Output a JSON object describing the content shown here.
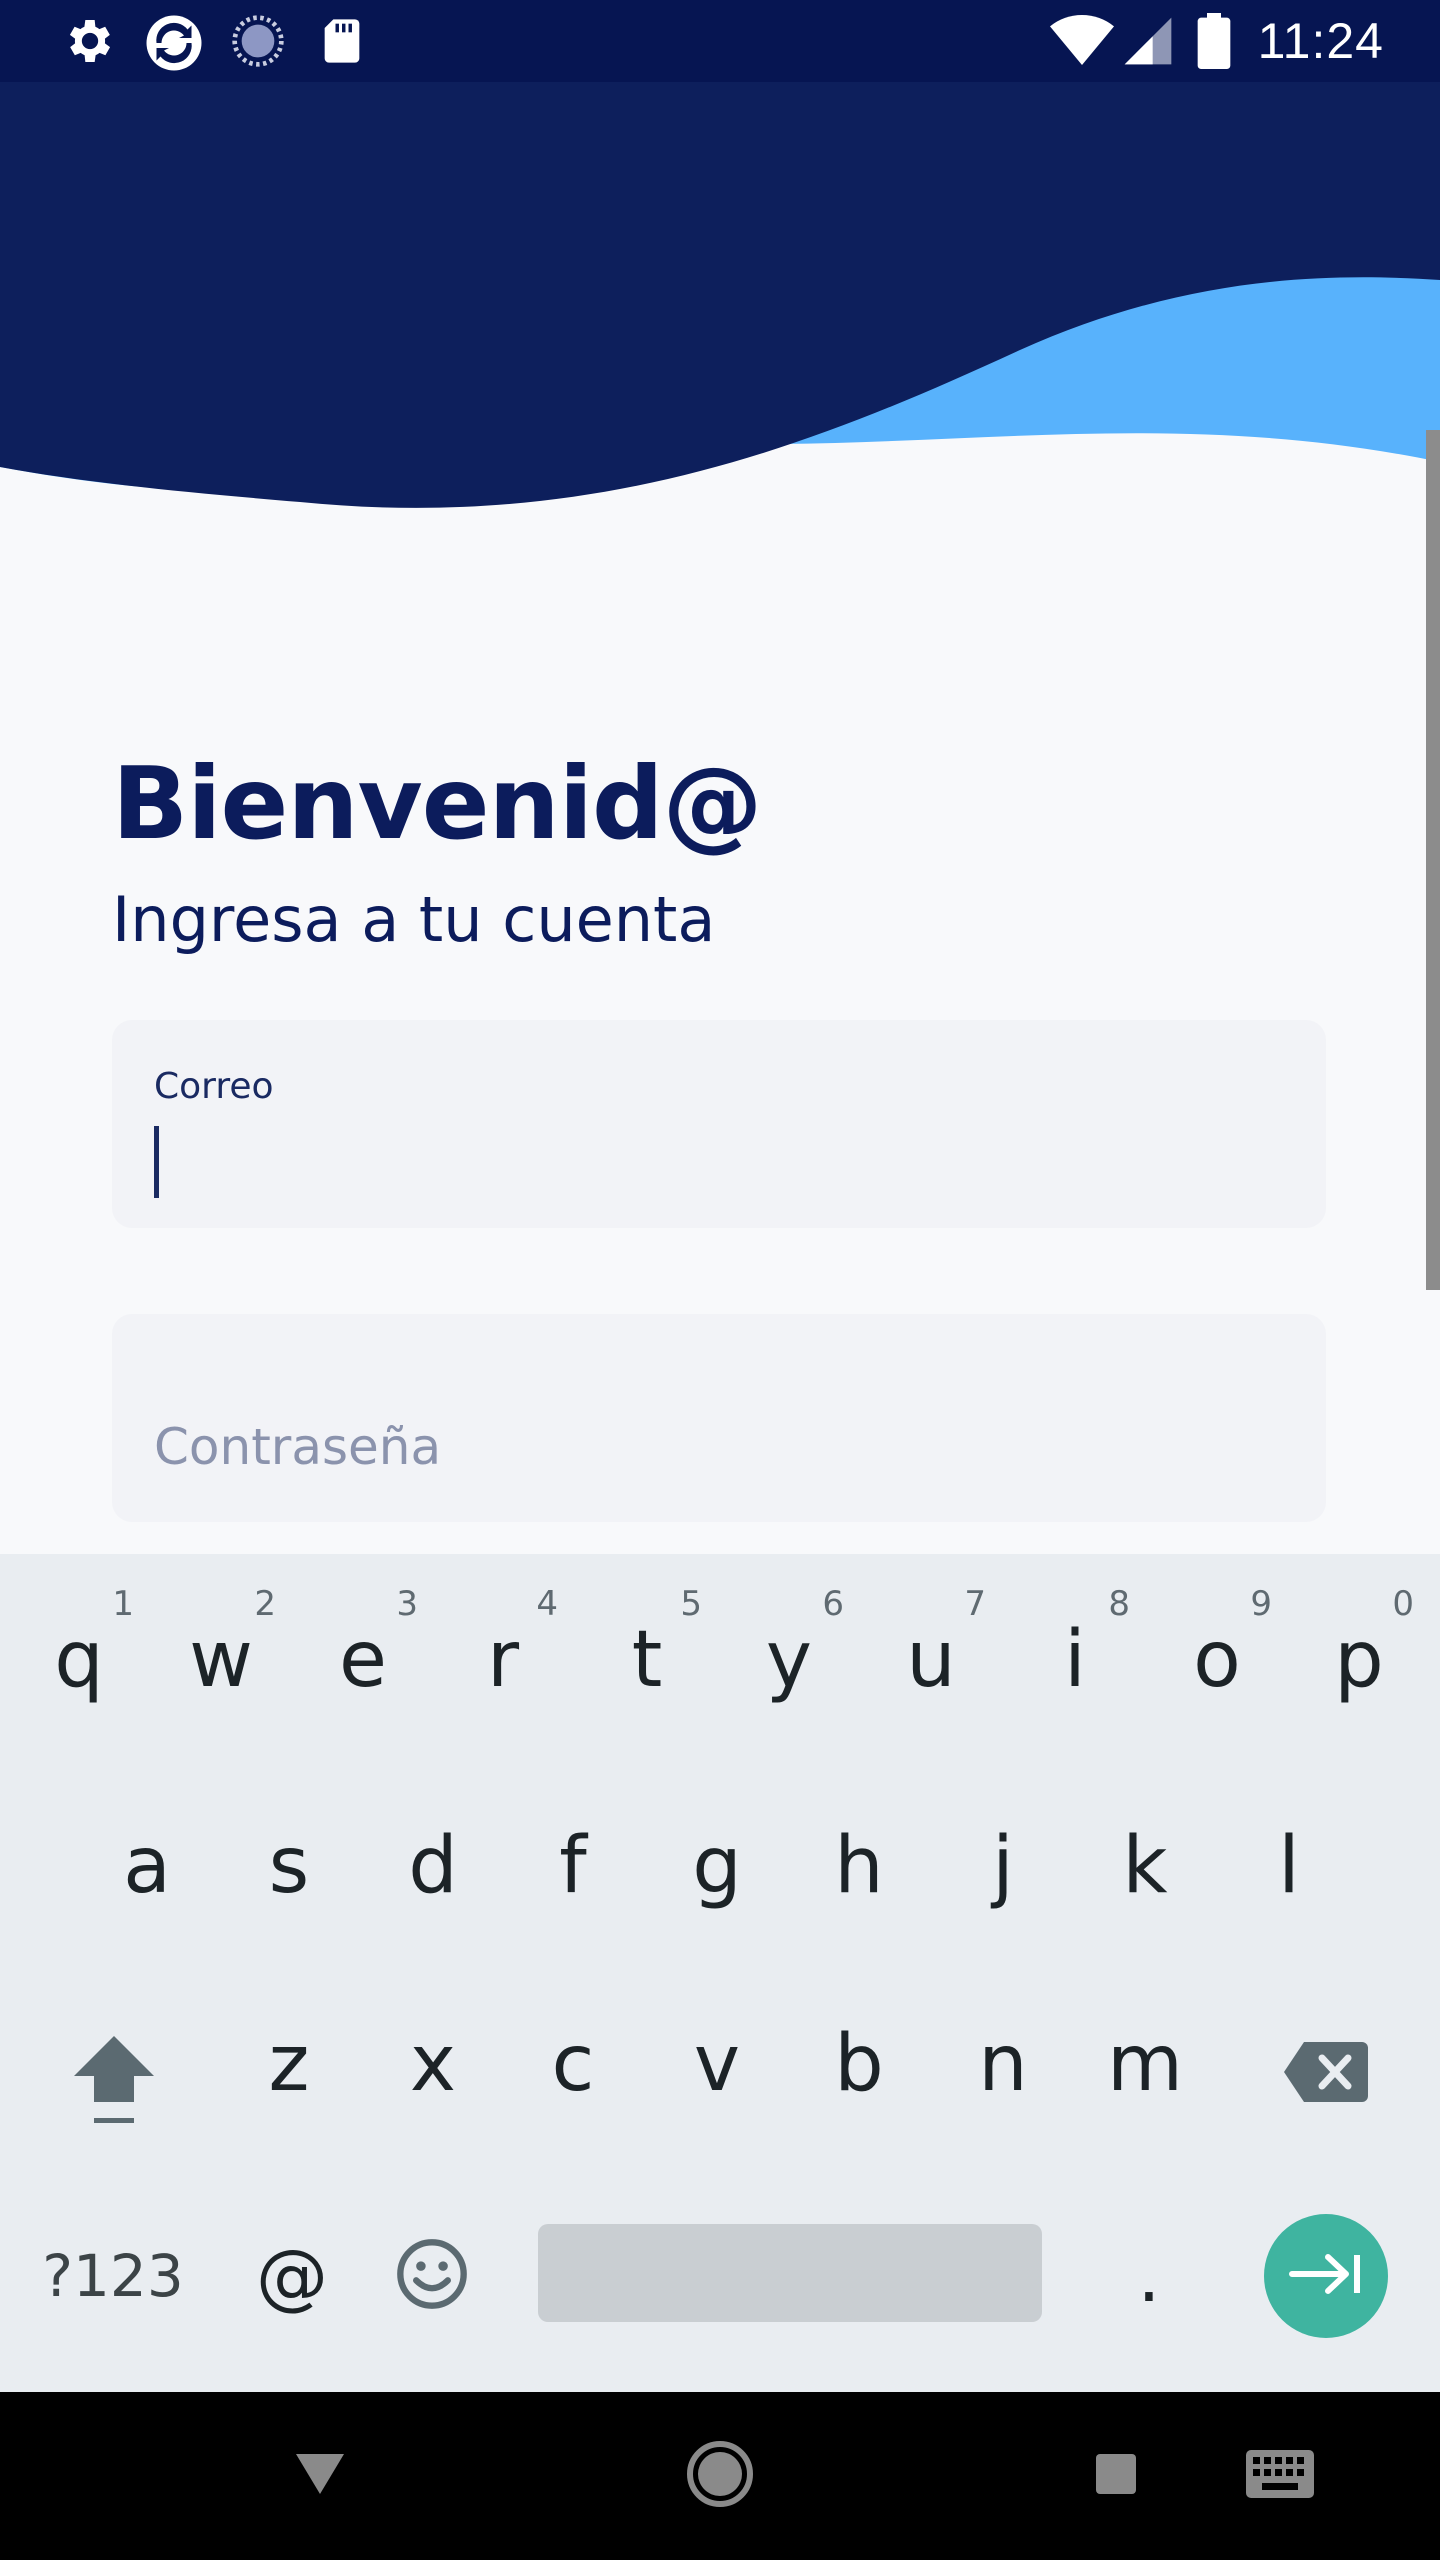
{
  "status_bar": {
    "time": "11:24",
    "left_icons": [
      "settings-icon",
      "sync-app-icon",
      "loading-icon",
      "sd-card-icon"
    ],
    "right_icons": [
      "wifi-icon",
      "signal-icon",
      "battery-icon"
    ]
  },
  "colors": {
    "brand_navy": "#0c1c5c",
    "header_navy": "#0d1f5c",
    "wave_blue": "#58b2fc",
    "accent_teal": "#3fb4a0",
    "field_bg": "#f2f3f7"
  },
  "welcome": {
    "title": "Bienvenid@",
    "subtitle": "Ingresa a tu cuenta"
  },
  "form": {
    "email": {
      "label": "Correo",
      "value": ""
    },
    "password": {
      "placeholder": "Contraseña",
      "value": ""
    }
  },
  "keyboard": {
    "row1": [
      {
        "letter": "q",
        "hint": "1"
      },
      {
        "letter": "w",
        "hint": "2"
      },
      {
        "letter": "e",
        "hint": "3"
      },
      {
        "letter": "r",
        "hint": "4"
      },
      {
        "letter": "t",
        "hint": "5"
      },
      {
        "letter": "y",
        "hint": "6"
      },
      {
        "letter": "u",
        "hint": "7"
      },
      {
        "letter": "i",
        "hint": "8"
      },
      {
        "letter": "o",
        "hint": "9"
      },
      {
        "letter": "p",
        "hint": "0"
      }
    ],
    "row2": [
      "a",
      "s",
      "d",
      "f",
      "g",
      "h",
      "j",
      "k",
      "l"
    ],
    "row3": [
      "z",
      "x",
      "c",
      "v",
      "b",
      "n",
      "m"
    ],
    "symbols_label": "?123",
    "at_label": "@",
    "period_label": "."
  },
  "nav_bar": {
    "buttons": [
      "back-icon",
      "home-icon",
      "recents-icon",
      "keyboard-switch-icon"
    ]
  }
}
